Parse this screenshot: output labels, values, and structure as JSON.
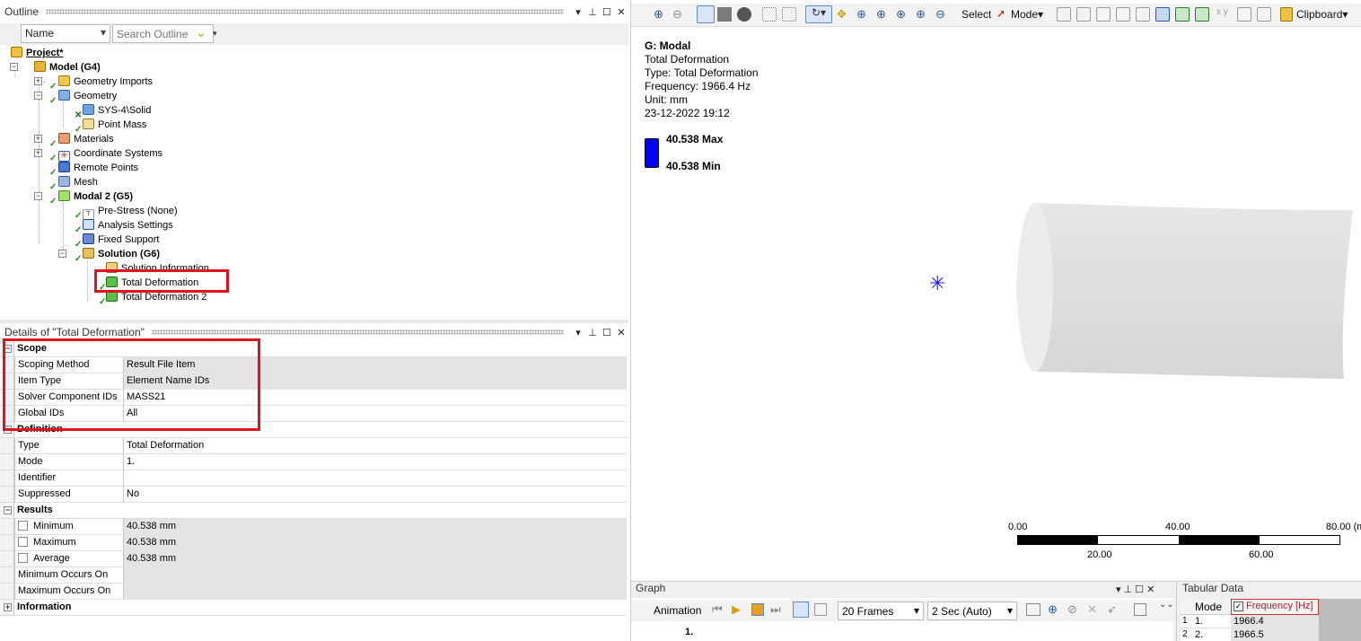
{
  "outline": {
    "title": "Outline",
    "filter_name": "Name",
    "search_placeholder": "Search Outline",
    "tree": [
      {
        "label": "Project*",
        "bold": true
      },
      {
        "label": "Model (G4)",
        "bold": true
      },
      {
        "label": "Geometry Imports"
      },
      {
        "label": "Geometry"
      },
      {
        "label": "SYS-4\\Solid"
      },
      {
        "label": "Point Mass"
      },
      {
        "label": "Materials"
      },
      {
        "label": "Coordinate Systems"
      },
      {
        "label": "Remote Points"
      },
      {
        "label": "Mesh"
      },
      {
        "label": "Modal 2 (G5)",
        "bold": true
      },
      {
        "label": "Pre-Stress (None)"
      },
      {
        "label": "Analysis Settings"
      },
      {
        "label": "Fixed Support"
      },
      {
        "label": "Solution (G6)",
        "bold": true
      },
      {
        "label": "Solution Information"
      },
      {
        "label": "Total Deformation",
        "selected": true
      },
      {
        "label": "Total Deformation 2"
      }
    ]
  },
  "details": {
    "title": "Details of \"Total Deformation\"",
    "sections": [
      {
        "name": "Scope",
        "rows": [
          {
            "k": "Scoping Method",
            "v": "Result File Item",
            "grey": true
          },
          {
            "k": "Item Type",
            "v": "Element Name IDs",
            "grey": true
          },
          {
            "k": "Solver Component IDs",
            "v": "MASS21",
            "grey": false
          },
          {
            "k": "Global IDs",
            "v": "All",
            "grey": false
          }
        ]
      },
      {
        "name": "Definition",
        "rows": [
          {
            "k": "Type",
            "v": "Total Deformation",
            "grey": false
          },
          {
            "k": "Mode",
            "v": "1.",
            "grey": false
          },
          {
            "k": "Identifier",
            "v": "",
            "grey": false
          },
          {
            "k": "Suppressed",
            "v": "No",
            "grey": false
          }
        ]
      },
      {
        "name": "Results",
        "rows": [
          {
            "k": "Minimum",
            "v": "40.538 mm",
            "grey": true,
            "chk": true
          },
          {
            "k": "Maximum",
            "v": "40.538 mm",
            "grey": true,
            "chk": true
          },
          {
            "k": "Average",
            "v": "40.538 mm",
            "grey": true,
            "chk": true
          },
          {
            "k": "Minimum Occurs On",
            "v": "",
            "grey": true
          },
          {
            "k": "Maximum Occurs On",
            "v": "",
            "grey": true
          }
        ]
      },
      {
        "name": "Information",
        "rows": []
      }
    ]
  },
  "toolbar": {
    "select": "Select",
    "mode": "Mode",
    "clipboard": "Clipboard"
  },
  "viewport": {
    "title": "G: Modal",
    "lines": [
      "Total Deformation",
      "Type: Total Deformation",
      "Frequency: 1966.4 Hz",
      "Unit: mm",
      "23-12-2022 19:12"
    ],
    "legend_max": "40.538 Max",
    "legend_min": "40.538 Min",
    "legend_color": "#0000ff",
    "scale_top": [
      "0.00",
      "40.00",
      "80.00 (m"
    ],
    "scale_bottom": [
      "20.00",
      "60.00"
    ]
  },
  "graph": {
    "title": "Graph",
    "animation": "Animation",
    "frames": "20 Frames",
    "duration": "2 Sec (Auto)",
    "mode_label": "1."
  },
  "tabular": {
    "title": "Tabular Data",
    "col_mode": "Mode",
    "col_freq": "Frequency [Hz]",
    "rows": [
      {
        "n": "1",
        "mode": "1.",
        "freq": "1966.4"
      },
      {
        "n": "2",
        "mode": "2.",
        "freq": "1966.5"
      }
    ]
  }
}
